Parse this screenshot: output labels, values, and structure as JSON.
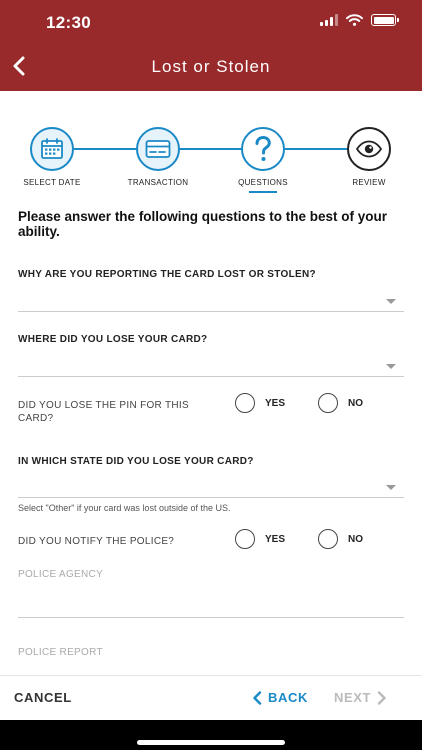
{
  "status_bar": {
    "time": "12:30"
  },
  "header": {
    "title": "Lost or Stolen"
  },
  "stepper": {
    "steps": [
      {
        "label": "SELECT DATE",
        "icon": "calendar-icon",
        "state": "done"
      },
      {
        "label": "TRANSACTION",
        "icon": "card-icon",
        "state": "done"
      },
      {
        "label": "QUESTIONS",
        "icon": "question-icon",
        "state": "current"
      },
      {
        "label": "REVIEW",
        "icon": "eye-icon",
        "state": "pending"
      }
    ]
  },
  "form": {
    "intro": "Please answer the following questions to the best of your ability.",
    "q_reason": {
      "label": "WHY ARE YOU REPORTING THE CARD LOST OR STOLEN?",
      "value": ""
    },
    "q_where": {
      "label": "WHERE DID YOU LOSE YOUR CARD?",
      "value": ""
    },
    "q_pin": {
      "label": "DID YOU LOSE THE PIN FOR THIS CARD?",
      "yes": "YES",
      "no": "NO"
    },
    "q_state": {
      "label": "IN WHICH STATE DID YOU LOSE YOUR CARD?",
      "value": "",
      "helper": "Select \"Other\" if your card was lost outside of the US."
    },
    "q_police": {
      "label": "DID YOU NOTIFY THE POLICE?",
      "yes": "YES",
      "no": "NO"
    },
    "police_agency": {
      "label": "POLICE AGENCY"
    },
    "police_report": {
      "label": "POLICE REPORT"
    }
  },
  "bottom_bar": {
    "cancel": "CANCEL",
    "back": "BACK",
    "next": "NEXT"
  },
  "colors": {
    "brand": "#992a2b",
    "accent": "#1a8ac7",
    "disabled": "#bbbbbb"
  }
}
